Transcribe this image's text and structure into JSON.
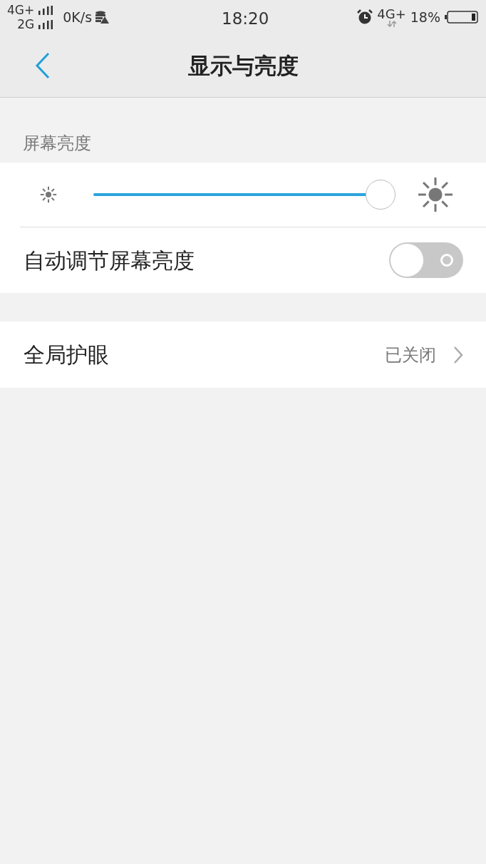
{
  "status_bar": {
    "network_1": "4G+",
    "network_2": "2G",
    "speed": "0K/s",
    "time": "18:20",
    "network_3": "4G+",
    "battery": "18%"
  },
  "header": {
    "title": "显示与亮度"
  },
  "brightness": {
    "label": "屏幕亮度",
    "level": 1.0,
    "auto": {
      "label": "自动调节屏幕亮度",
      "on": false
    }
  },
  "eye_care": {
    "label": "全局护眼",
    "value": "已关闭"
  }
}
